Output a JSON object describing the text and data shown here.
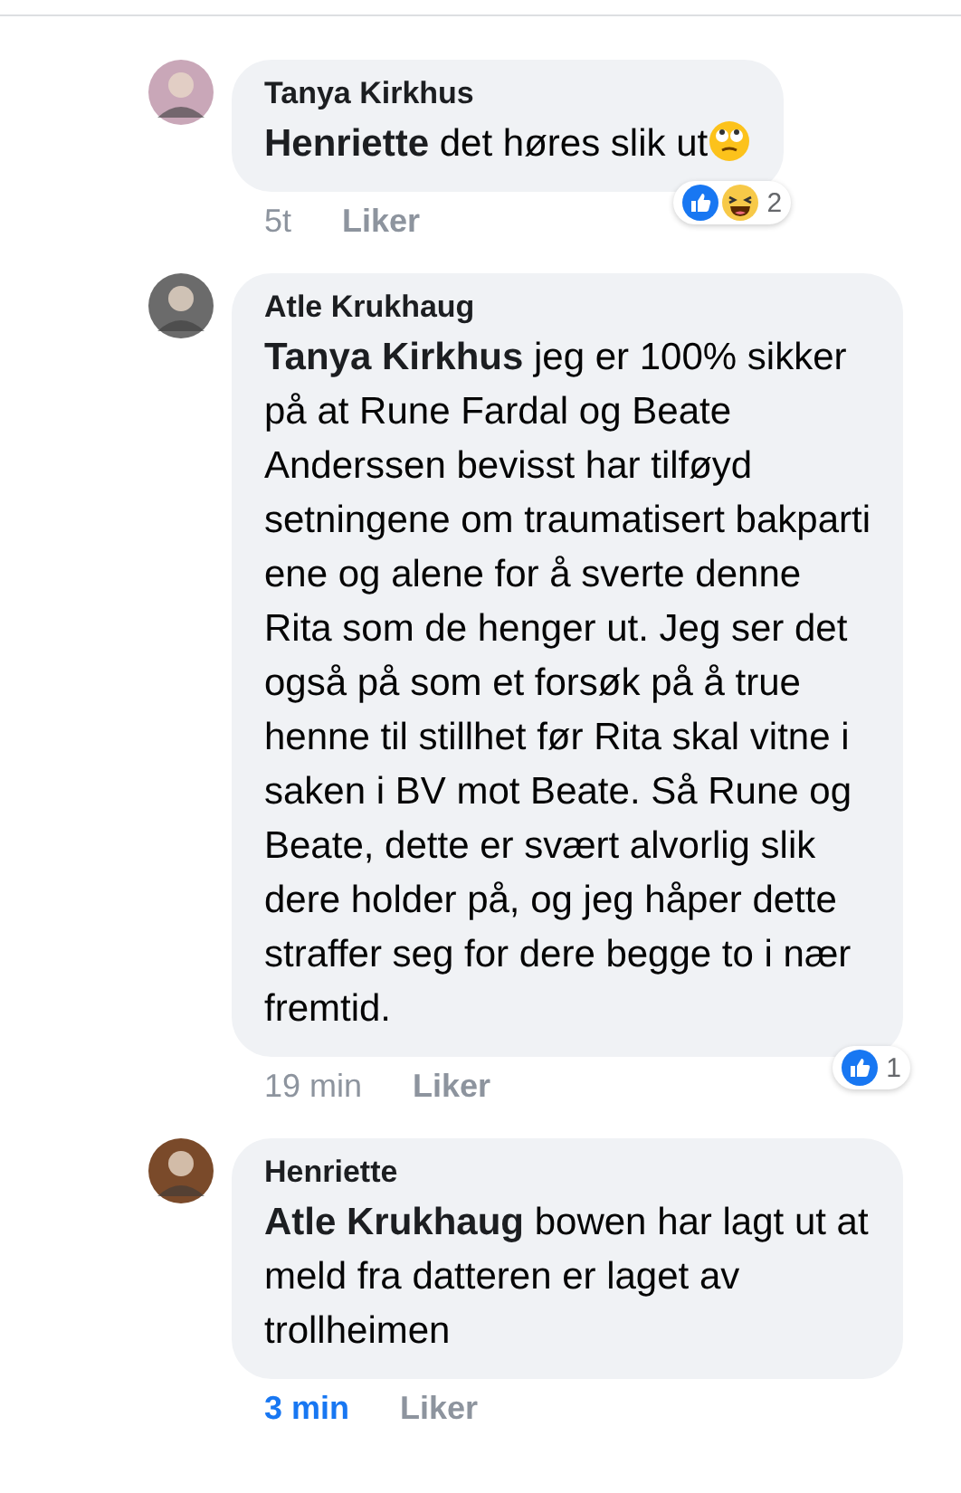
{
  "comments": [
    {
      "author": "Tanya Kirkhus",
      "body": "**Henriette** det høres slik ut",
      "trailing_emoji": {
        "kind": "eyeroll"
      },
      "time": "5t",
      "time_highlighted": false,
      "like_label": "Liker",
      "reactions": {
        "kinds": [
          {
            "kind": "like"
          },
          {
            "kind": "haha"
          }
        ],
        "count": "2"
      }
    },
    {
      "author": "Atle Krukhaug",
      "body": "**Tanya Kirkhus** jeg er 100% sikker på at Rune Fardal og Beate Anderssen bevisst har tilføyd setningene om traumatisert bakparti ene og alene for å sverte denne Rita som de henger ut. Jeg ser det også på som et forsøk på å true henne til stillhet før Rita skal vitne i saken i BV mot Beate. Så Rune og Beate, dette er svært alvorlig slik dere holder på, og jeg håper dette straffer seg for dere begge to i nær fremtid.",
      "time": "19 min",
      "time_highlighted": false,
      "like_label": "Liker",
      "reactions": {
        "kinds": [
          {
            "kind": "like"
          }
        ],
        "count": "1"
      }
    },
    {
      "author": "Henriette",
      "body": "**Atle Krukhaug** bowen har lagt ut at meld fra datteren er laget av trollheimen",
      "time": "3 min",
      "time_highlighted": true,
      "like_label": "Liker"
    }
  ]
}
